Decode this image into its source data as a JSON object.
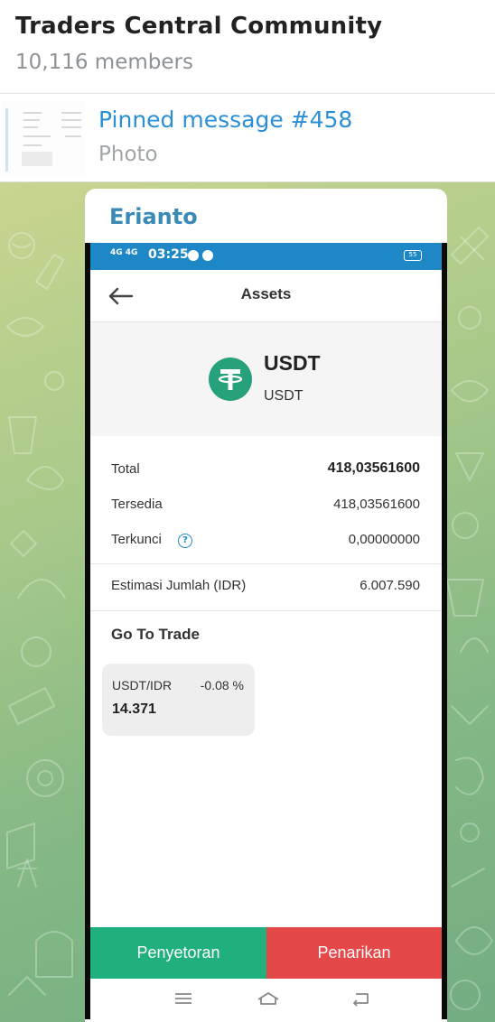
{
  "chat": {
    "title": "Traders Central Community",
    "members": "10,116 members"
  },
  "pinned": {
    "title": "Pinned message #458",
    "type": "Photo"
  },
  "message": {
    "sender": "Erianto"
  },
  "phone": {
    "status": {
      "network": "4G 4G",
      "time": "03:25",
      "battery": "55"
    },
    "screen_title": "Assets",
    "coin": {
      "symbol": "USDT",
      "name": "USDT"
    },
    "rows": {
      "total_label": "Total",
      "total_value": "418,03561600",
      "available_label": "Tersedia",
      "available_value": "418,03561600",
      "locked_label": "Terkunci",
      "locked_value": "0,00000000",
      "estimate_label": "Estimasi Jumlah (IDR)",
      "estimate_value": "6.007.590"
    },
    "trade": {
      "section_title": "Go To Trade",
      "pair": "USDT/IDR",
      "change": "-0.08 %",
      "price": "14.371"
    },
    "buttons": {
      "deposit": "Penyetoran",
      "withdraw": "Penarikan"
    }
  },
  "colors": {
    "accent_blue": "#2b8fd6",
    "status_bar": "#1e88c7",
    "tether_green": "#26a17b",
    "deposit_green": "#1fb07d",
    "withdraw_red": "#e44848"
  },
  "icons": {
    "back": "arrow-left-icon",
    "help": "question-circle-icon",
    "tether": "tether-logo-icon",
    "nav_menu": "menu-icon",
    "nav_home": "home-icon",
    "nav_back": "back-icon"
  }
}
